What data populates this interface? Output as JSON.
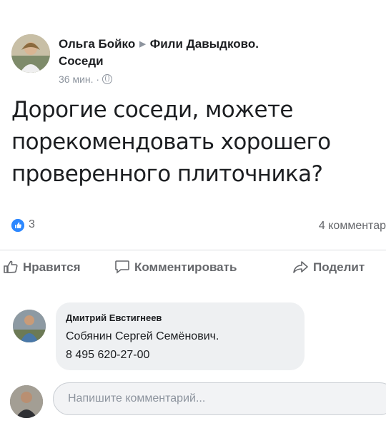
{
  "post": {
    "author": "Ольга Бойко",
    "group": "Фили Давыдково.",
    "group_line2": "Соседи",
    "time": "36 мин. ·",
    "text": "Дорогие соседи, можете порекомендовать хорошего проверенного плиточника?",
    "likes_count": "3",
    "comments_count": "4 комментар"
  },
  "actions": {
    "like": "Нравится",
    "comment": "Комментировать",
    "share": "Поделит"
  },
  "comment": {
    "author": "Дмитрий Евстигнеев",
    "line1": "Собянин Сергей Семёнович.",
    "line2": "8 495 620-27-00"
  },
  "reply": {
    "placeholder": "Напишите комментарий..."
  },
  "colors": {
    "like_blue": "#2d88ff",
    "secondary_text": "#65676b",
    "bubble_bg": "#eef0f2"
  },
  "icons": {
    "globe": "globe-icon",
    "like": "thumbs-up-icon",
    "comment": "speech-bubble-icon",
    "share": "share-arrow-icon"
  }
}
